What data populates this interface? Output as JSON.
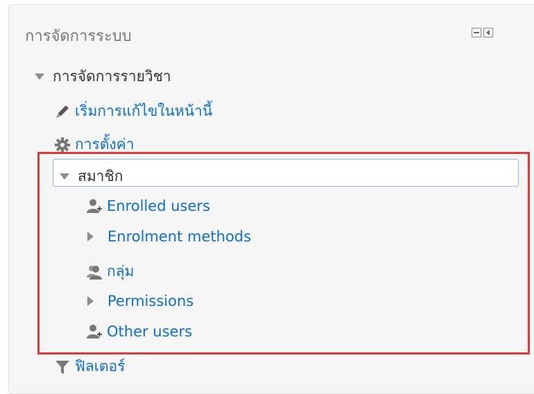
{
  "block": {
    "title": "การจัดการระบบ",
    "controls": [
      "minimize-icon",
      "dock-icon"
    ]
  },
  "tree": {
    "course_admin": {
      "label": "การจัดการรายวิชา",
      "icon": "triangle-down-icon",
      "expanded": true
    },
    "turn_editing": {
      "label": "เริ่มการแก้ไขในหน้านี้",
      "icon": "pencil-icon"
    },
    "settings": {
      "label": "การตั้งค่า",
      "icon": "gear-icon"
    },
    "users": {
      "label": "สมาชิก",
      "icon": "triangle-down-icon",
      "expanded": true,
      "selected": true
    },
    "enrolled_users": {
      "label": "Enrolled users",
      "icon": "enrol-user-icon"
    },
    "enrolment_methods": {
      "label": "Enrolment methods",
      "icon": "triangle-right-icon"
    },
    "groups": {
      "label": "กลุ่ม",
      "icon": "group-icon"
    },
    "permissions": {
      "label": "Permissions",
      "icon": "triangle-right-icon"
    },
    "other_users": {
      "label": "Other users",
      "icon": "enrol-user-icon"
    },
    "filters": {
      "label": "ฟิลเตอร์",
      "icon": "filter-icon"
    }
  },
  "colors": {
    "link": "#0f6fc5",
    "text": "#333333",
    "title": "#777777",
    "highlight": "#e0393b",
    "selection_border": "#8fb3e6"
  }
}
